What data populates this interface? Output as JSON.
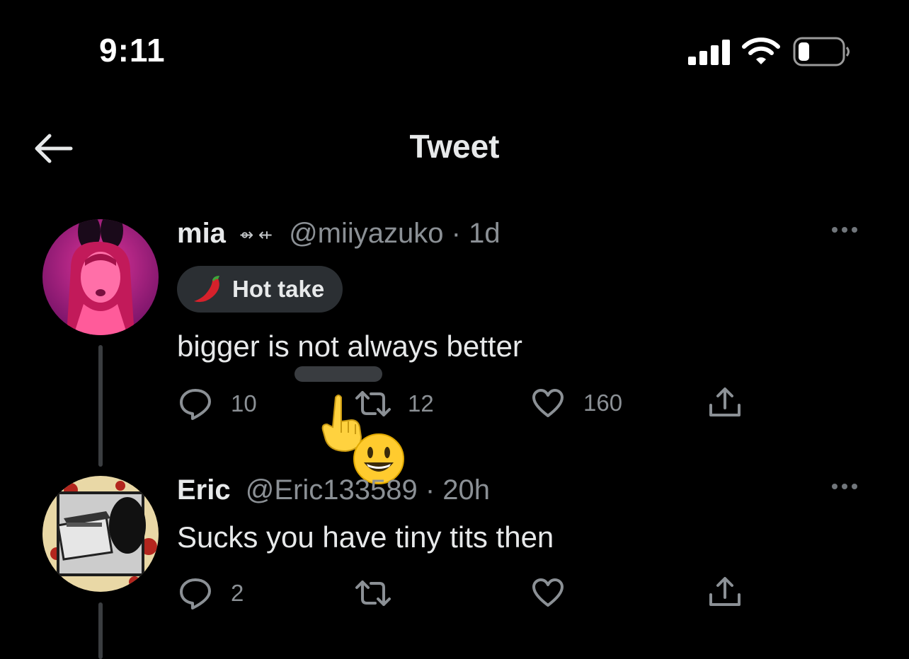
{
  "status_bar": {
    "time": "9:11"
  },
  "header": {
    "title": "Tweet"
  },
  "tweets": [
    {
      "display_name": "mia",
      "name_decoration": "⇴ ⇷",
      "handle": "@miiyazuko",
      "time_ago": "1d",
      "topic": "Hot take",
      "text": "bigger is not always better",
      "replies": "10",
      "retweets": "12",
      "likes": "160"
    },
    {
      "display_name": "Eric",
      "handle": "@Eric133589",
      "time_ago": "20h",
      "text": "Sucks you have tiny tits then",
      "replies": "2"
    }
  ],
  "separator": "·",
  "icons": {
    "back": "arrow-left-icon",
    "more": "more-horizontal-icon",
    "reply": "reply-icon",
    "retweet": "retweet-icon",
    "like": "heart-icon",
    "share": "share-icon",
    "topic": "chili-pepper-icon"
  },
  "colors": {
    "background": "#000000",
    "text": "#e7e9ea",
    "muted": "#8b9095",
    "pill": "#2b2f33"
  }
}
